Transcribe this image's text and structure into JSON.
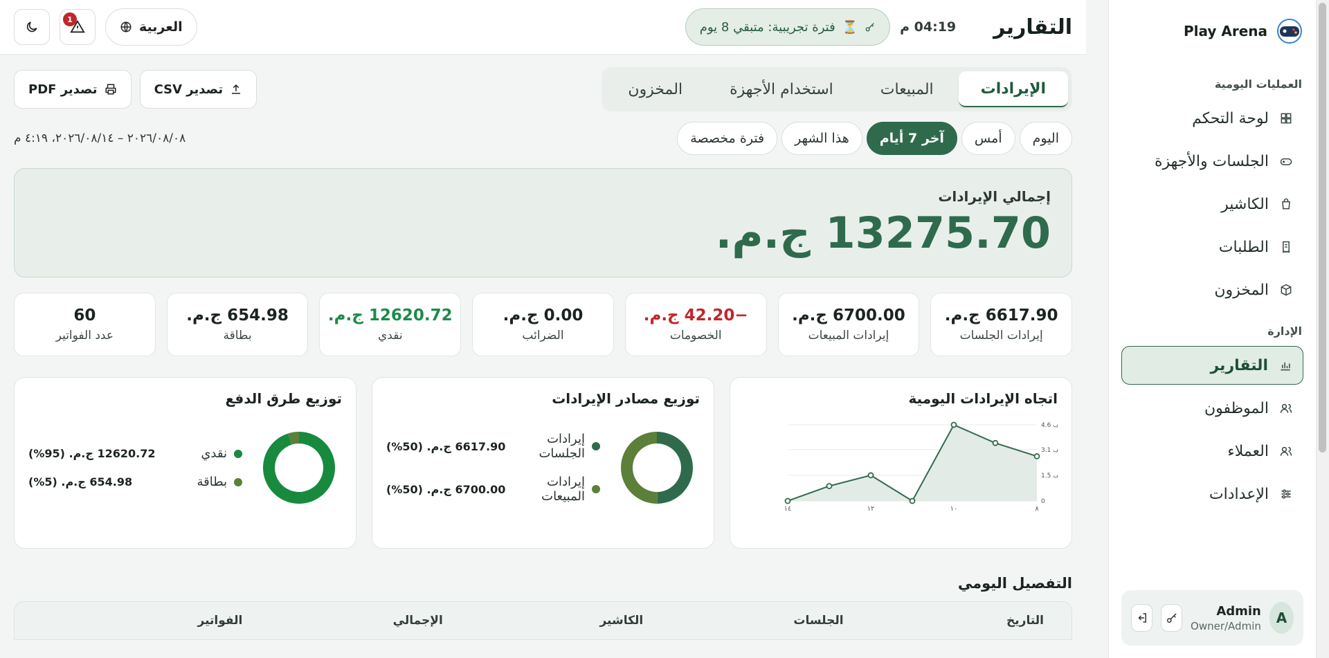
{
  "brand": {
    "name": "Play Arena"
  },
  "sidebar": {
    "section_ops": "العمليات اليومية",
    "section_admin": "الإدارة",
    "ops_items": [
      {
        "label": "لوحة التحكم",
        "icon": "grid-icon"
      },
      {
        "label": "الجلسات والأجهزة",
        "icon": "gamepad-icon"
      },
      {
        "label": "الكاشير",
        "icon": "bag-icon"
      },
      {
        "label": "الطلبات",
        "icon": "receipt-icon"
      },
      {
        "label": "المخزون",
        "icon": "box-icon"
      }
    ],
    "admin_items": [
      {
        "label": "التقارير",
        "icon": "chart-icon",
        "active": true
      },
      {
        "label": "الموظفون",
        "icon": "users-icon"
      },
      {
        "label": "العملاء",
        "icon": "users-icon"
      },
      {
        "label": "الإعدادات",
        "icon": "sliders-icon"
      }
    ],
    "user": {
      "initial": "A",
      "name": "Admin",
      "role": "Owner/Admin"
    }
  },
  "topbar": {
    "title": "التقارير",
    "clock": "04:19 م",
    "trial": "فترة تجريبية: متبقي 8 يوم",
    "language": "العربية",
    "alert_count": "1"
  },
  "tabs": [
    "الإيرادات",
    "المبيعات",
    "استخدام الأجهزة",
    "المخزون"
  ],
  "export": {
    "csv": "تصدير CSV",
    "pdf": "تصدير PDF"
  },
  "periods": [
    "اليوم",
    "أمس",
    "آخر 7 أيام",
    "هذا الشهر",
    "فترة مخصصة"
  ],
  "active_period": 2,
  "range_text": "٢٠٢٦/٠٨/٠٨ – ٢٠٢٦/٠٨/١٤، ٤:١٩ م",
  "total": {
    "label": "إجمالي الإيرادات",
    "value": "13275.70 ج.م."
  },
  "kpis": [
    {
      "value": "6617.90 ج.م.",
      "label": "إيرادات الجلسات",
      "tone": ""
    },
    {
      "value": "6700.00 ج.م.",
      "label": "إيرادات المبيعات",
      "tone": ""
    },
    {
      "value": "−42.20 ج.م.",
      "label": "الخصومات",
      "tone": "red"
    },
    {
      "value": "0.00 ج.م.",
      "label": "الضرائب",
      "tone": ""
    },
    {
      "value": "12620.72 ج.م.",
      "label": "نقدي",
      "tone": "green"
    },
    {
      "value": "654.98 ج.م.",
      "label": "بطاقة",
      "tone": ""
    },
    {
      "value": "60",
      "label": "عدد الفواتير",
      "tone": ""
    }
  ],
  "charts": {
    "trend_title": "اتجاه الإيرادات اليومية",
    "sources_title": "توزيع مصادر الإيرادات",
    "payments_title": "توزيع طرق الدفع"
  },
  "chart_data": [
    {
      "type": "line",
      "title": "اتجاه الإيرادات اليومية",
      "x": [
        "٨",
        "٩",
        "١٠",
        "١١",
        "١٢",
        "١٣",
        "١٤"
      ],
      "x_tick_labels": [
        "٨",
        "١٠",
        "١٢",
        "١٤"
      ],
      "values": [
        2700,
        3500,
        4600,
        0,
        1550,
        900,
        0
      ],
      "y_tick_labels": [
        "0",
        "1.5 ألف",
        "3.1 ألف",
        "4.6 ألف"
      ],
      "y_ticks": [
        0,
        1550,
        3100,
        4600
      ],
      "ylim": [
        0,
        4600
      ],
      "grid": true,
      "colors": {
        "line": "#2f6a4d",
        "fill": "#e3ebe6"
      }
    },
    {
      "type": "pie",
      "title": "توزيع مصادر الإيرادات",
      "slices": [
        {
          "name": "إيرادات الجلسات",
          "value": 6617.9,
          "display": "6617.90 ج.م. (50%)",
          "color": "#2f6a4d"
        },
        {
          "name": "إيرادات المبيعات",
          "value": 6700.0,
          "display": "6700.00 ج.م. (50%)",
          "color": "#5c7f3a"
        }
      ]
    },
    {
      "type": "pie",
      "title": "توزيع طرق الدفع",
      "slices": [
        {
          "name": "نقدي",
          "value": 12620.72,
          "display": "12620.72 ج.م. (95%)",
          "color": "#178a3e"
        },
        {
          "name": "بطاقة",
          "value": 654.98,
          "display": "654.98 ج.م. (5%)",
          "color": "#5c7f3a"
        }
      ]
    }
  ],
  "daily": {
    "title": "التفصيل اليومي",
    "columns": [
      "التاريخ",
      "الجلسات",
      "الكاشير",
      "الإجمالي",
      "الفواتير"
    ]
  }
}
